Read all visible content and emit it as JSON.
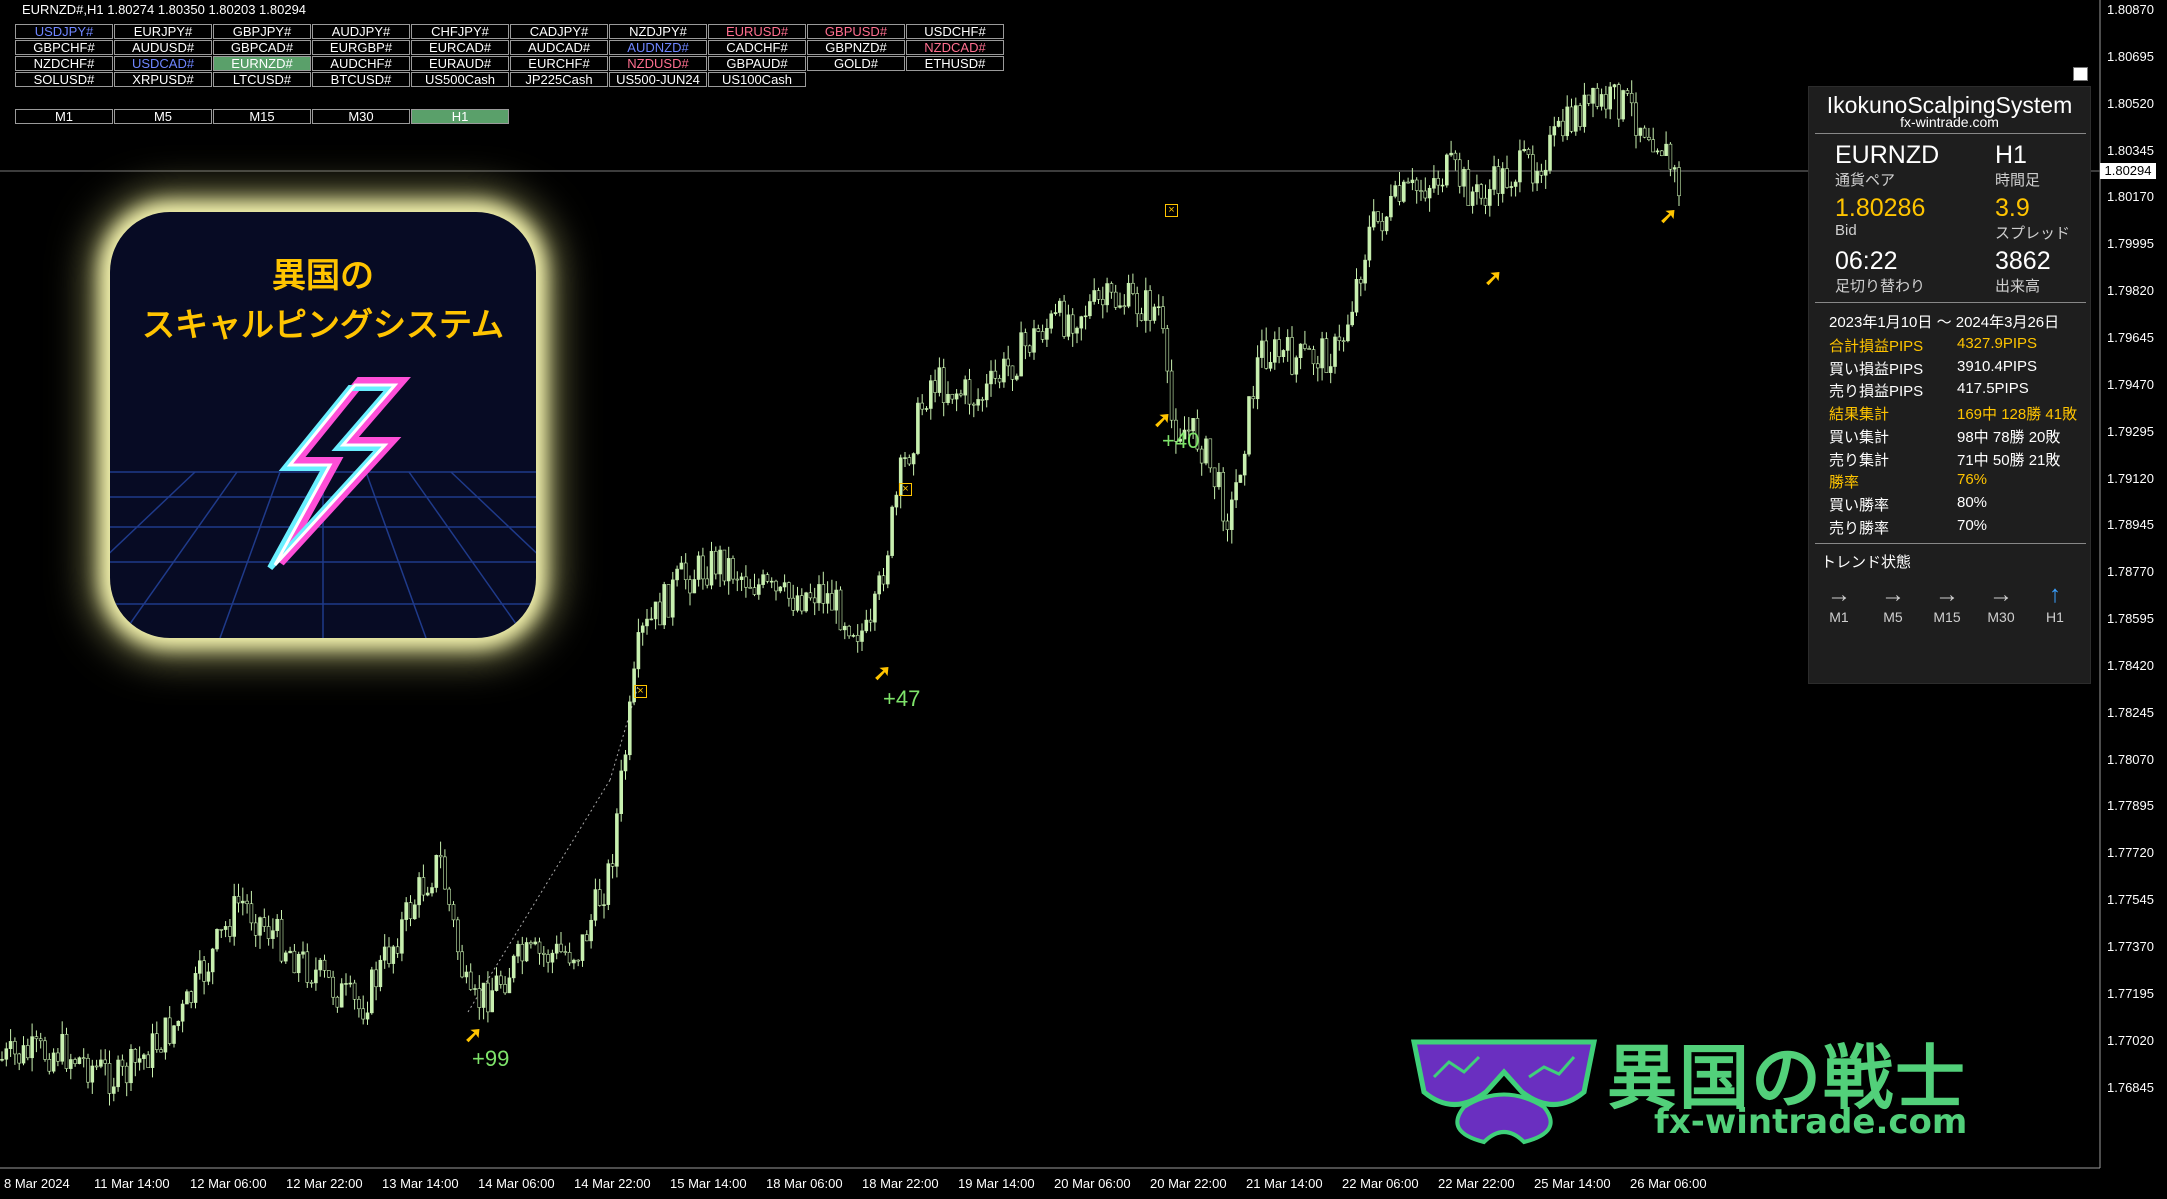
{
  "window": {
    "title": "EURNZD#,H1  1.80274 1.80350 1.80203 1.80294"
  },
  "symbols": [
    {
      "label": "USDJPY#",
      "style": "blue"
    },
    {
      "label": "EURJPY#",
      "style": ""
    },
    {
      "label": "GBPJPY#",
      "style": ""
    },
    {
      "label": "AUDJPY#",
      "style": ""
    },
    {
      "label": "CHFJPY#",
      "style": ""
    },
    {
      "label": "CADJPY#",
      "style": ""
    },
    {
      "label": "NZDJPY#",
      "style": ""
    },
    {
      "label": "EURUSD#",
      "style": "pink"
    },
    {
      "label": "GBPUSD#",
      "style": "pink"
    },
    {
      "label": "USDCHF#",
      "style": ""
    },
    {
      "label": "GBPCHF#",
      "style": ""
    },
    {
      "label": "AUDUSD#",
      "style": ""
    },
    {
      "label": "GBPCAD#",
      "style": ""
    },
    {
      "label": "EURGBP#",
      "style": ""
    },
    {
      "label": "EURCAD#",
      "style": ""
    },
    {
      "label": "AUDCAD#",
      "style": ""
    },
    {
      "label": "AUDNZD#",
      "style": "blue"
    },
    {
      "label": "CADCHF#",
      "style": ""
    },
    {
      "label": "GBPNZD#",
      "style": ""
    },
    {
      "label": "NZDCAD#",
      "style": "pink"
    },
    {
      "label": "NZDCHF#",
      "style": ""
    },
    {
      "label": "USDCAD#",
      "style": "blue"
    },
    {
      "label": "EURNZD#",
      "style": "active"
    },
    {
      "label": "AUDCHF#",
      "style": ""
    },
    {
      "label": "EURAUD#",
      "style": ""
    },
    {
      "label": "EURCHF#",
      "style": ""
    },
    {
      "label": "NZDUSD#",
      "style": "pink"
    },
    {
      "label": "GBPAUD#",
      "style": ""
    },
    {
      "label": "GOLD#",
      "style": ""
    },
    {
      "label": "ETHUSD#",
      "style": ""
    },
    {
      "label": "SOLUSD#",
      "style": ""
    },
    {
      "label": "XRPUSD#",
      "style": ""
    },
    {
      "label": "LTCUSD#",
      "style": ""
    },
    {
      "label": "BTCUSD#",
      "style": ""
    },
    {
      "label": "US500Cash",
      "style": ""
    },
    {
      "label": "JP225Cash",
      "style": ""
    },
    {
      "label": "US500-JUN24",
      "style": ""
    },
    {
      "label": "US100Cash",
      "style": ""
    }
  ],
  "timeframes": [
    {
      "label": "M1",
      "active": false
    },
    {
      "label": "M5",
      "active": false
    },
    {
      "label": "M15",
      "active": false
    },
    {
      "label": "M30",
      "active": false
    },
    {
      "label": "H1",
      "active": true
    }
  ],
  "logo": {
    "line1": "異国の",
    "line2": "スキャルピングシステム"
  },
  "panel": {
    "title": "IkokunoScalpingSystem",
    "subtitle": "fx-wintrade.com",
    "pair": "EURNZD",
    "pair_label": "通貨ペア",
    "timeframe": "H1",
    "timeframe_label": "時間足",
    "bid": "1.80286",
    "bid_label": "Bid",
    "spread": "3.9",
    "spread_label": "スプレッド",
    "bar_time": "06:22",
    "bar_time_label": "足切り替わり",
    "volume": "3862",
    "volume_label": "出来高",
    "period": "2023年1月10日 ～ 2024年3月26日",
    "stats": [
      {
        "label": "合計損益PIPS",
        "value": "4327.9PIPS",
        "highlight": true
      },
      {
        "label": "買い損益PIPS",
        "value": "3910.4PIPS",
        "highlight": false
      },
      {
        "label": "売り損益PIPS",
        "value": "417.5PIPS",
        "highlight": false
      },
      {
        "label": "結果集計",
        "value": "169中 128勝 41敗",
        "highlight": true
      },
      {
        "label": "買い集計",
        "value": "98中 78勝 20敗",
        "highlight": false
      },
      {
        "label": "売り集計",
        "value": "71中 50勝 21敗",
        "highlight": false
      },
      {
        "label": "勝率",
        "value": "76%",
        "highlight": true
      },
      {
        "label": "買い勝率",
        "value": "80%",
        "highlight": false
      },
      {
        "label": "売り勝率",
        "value": "70%",
        "highlight": false
      }
    ],
    "trend_title": "トレンド状態",
    "trend": [
      {
        "tf": "M1",
        "arrow": "→",
        "up": false
      },
      {
        "tf": "M5",
        "arrow": "→",
        "up": false
      },
      {
        "tf": "M15",
        "arrow": "→",
        "up": false
      },
      {
        "tf": "M30",
        "arrow": "→",
        "up": false
      },
      {
        "tf": "H1",
        "arrow": "↑",
        "up": true
      }
    ]
  },
  "price_axis": [
    "1.80870",
    "1.80695",
    "1.80520",
    "1.80345",
    "1.80170",
    "1.79995",
    "1.79820",
    "1.79645",
    "1.79470",
    "1.79295",
    "1.79120",
    "1.78945",
    "1.78770",
    "1.78595",
    "1.78420",
    "1.78245",
    "1.78070",
    "1.77895",
    "1.77720",
    "1.77545",
    "1.77370",
    "1.77195",
    "1.77020",
    "1.76845"
  ],
  "current_price": "1.80294",
  "time_axis": [
    "8 Mar 2024",
    "11 Mar 14:00",
    "12 Mar 06:00",
    "12 Mar 22:00",
    "13 Mar 14:00",
    "14 Mar 06:00",
    "14 Mar 22:00",
    "15 Mar 14:00",
    "18 Mar 06:00",
    "18 Mar 22:00",
    "19 Mar 14:00",
    "20 Mar 06:00",
    "20 Mar 22:00",
    "21 Mar 14:00",
    "22 Mar 06:00",
    "22 Mar 22:00",
    "25 Mar 14:00",
    "26 Mar 06:00"
  ],
  "signals": [
    {
      "pips": "+99"
    },
    {
      "pips": "+47"
    },
    {
      "pips": "+40"
    }
  ],
  "brand": {
    "name": "異国の戦士",
    "url": "fx-wintrade.com"
  },
  "colors": {
    "candle": "#c8f0b0",
    "signal": "#ffc400",
    "pips": "#7ee36a",
    "active_button": "#5aa06a"
  }
}
